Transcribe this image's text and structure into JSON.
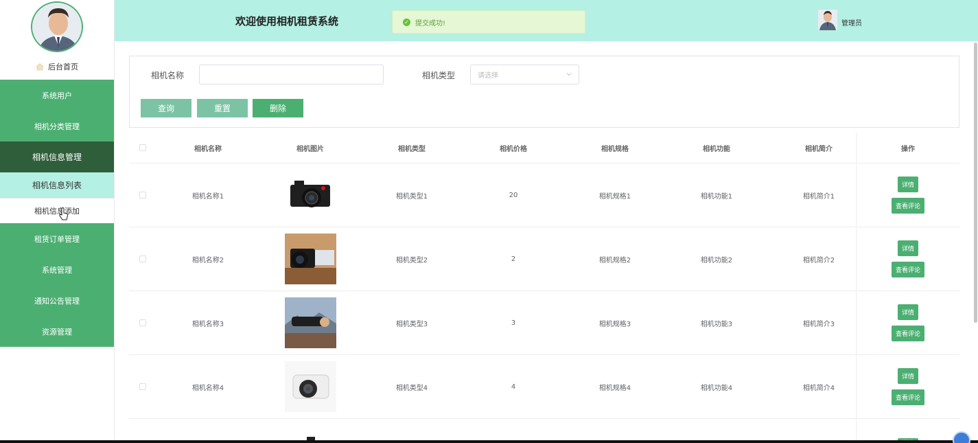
{
  "header": {
    "title": "欢迎使用相机租赁系统",
    "toast": "提交成功!",
    "user": "管理员"
  },
  "sidebar": {
    "home": "后台首页",
    "menu_top": [
      {
        "label": "系统用户"
      },
      {
        "label": "相机分类管理"
      },
      {
        "label": "相机信息管理"
      }
    ],
    "submenu": [
      {
        "label": "相机信息列表"
      },
      {
        "label": "相机信息添加"
      }
    ],
    "menu_bottom": [
      {
        "label": "租赁订单管理"
      },
      {
        "label": "系统管理"
      },
      {
        "label": "通知公告管理"
      },
      {
        "label": "资源管理"
      }
    ]
  },
  "search": {
    "name_label": "相机名称",
    "name_value": "",
    "type_label": "相机类型",
    "type_placeholder": "请选择",
    "query_btn": "查询",
    "reset_btn": "重置",
    "delete_btn": "删除"
  },
  "table": {
    "headers": [
      "相机名称",
      "相机图片",
      "相机类型",
      "相机价格",
      "相机规格",
      "相机功能",
      "相机简介",
      "操作"
    ],
    "rows": [
      {
        "name": "相机名称1",
        "type": "相机类型1",
        "price": "20",
        "spec": "相机规格1",
        "func": "相机功能1",
        "intro": "相机简介1",
        "image": "black-leica-camera"
      },
      {
        "name": "相机名称2",
        "type": "相机类型2",
        "price": "2",
        "spec": "相机规格2",
        "func": "相机功能2",
        "intro": "相机简介2",
        "image": "dslr-on-desk"
      },
      {
        "name": "相机名称3",
        "type": "相机类型3",
        "price": "3",
        "spec": "相机规格3",
        "func": "相机功能3",
        "intro": "相机简介3",
        "image": "telephoto-lens-mountains"
      },
      {
        "name": "相机名称4",
        "type": "相机类型4",
        "price": "4",
        "spec": "相机规格4",
        "func": "相机功能4",
        "intro": "相机简介4",
        "image": "white-mirrorless-camera"
      }
    ],
    "detail_btn": "详情",
    "comment_btn": "查看评论",
    "partial_detail_btn": "详情"
  },
  "colors": {
    "accent": "#4caf72",
    "header_bg": "#b4f0e3",
    "active_menu": "#2e5e3a"
  }
}
